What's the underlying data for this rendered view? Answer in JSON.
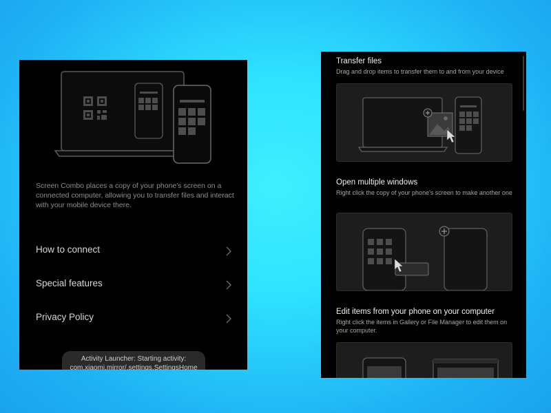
{
  "left_screen": {
    "description": "Screen Combo places a copy of your phone's screen on a connected computer, allowing you to transfer files and interact with your mobile device there.",
    "menu": [
      {
        "label": "How to connect"
      },
      {
        "label": "Special features"
      },
      {
        "label": "Privacy Policy"
      }
    ],
    "toast": {
      "line1": "Activity Launcher: Starting activity:",
      "line2": "com.xiaomi.mirror/.settings.SettingsHome"
    }
  },
  "right_screen": {
    "sections": [
      {
        "title": "Transfer files",
        "description": "Drag and drop items to transfer them to and from your device"
      },
      {
        "title": "Open multiple windows",
        "description": "Right click the copy of your phone's screen to make another one"
      },
      {
        "title": "Edit items from your phone on your computer",
        "description": "Right click the items in Gallery or File Manager to edit them on your computer."
      }
    ]
  },
  "colors": {
    "background": "#2ee1ff",
    "screen": "#000000",
    "illustration_stroke": "#5a5a5a"
  },
  "icons": [
    "qr-code-icon",
    "chevron-right-icon",
    "plus-circle-icon",
    "cursor-icon",
    "image-icon"
  ]
}
